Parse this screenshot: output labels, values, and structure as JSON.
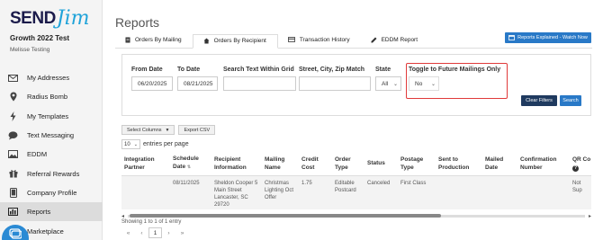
{
  "brand": {
    "send": "SEND",
    "jim": "Jim"
  },
  "account": {
    "name": "Growth 2022 Test",
    "user": "Melisse Testing"
  },
  "sidebar": {
    "items": [
      {
        "label": "My Addresses",
        "icon": "envelope-icon"
      },
      {
        "label": "Radius Bomb",
        "icon": "location-pin-icon"
      },
      {
        "label": "My Templates",
        "icon": "lightning-icon"
      },
      {
        "label": "Text Messaging",
        "icon": "chat-icon"
      },
      {
        "label": "EDDM",
        "icon": "image-icon"
      },
      {
        "label": "Referral Rewards",
        "icon": "gift-icon"
      },
      {
        "label": "Company Profile",
        "icon": "tablet-icon"
      },
      {
        "label": "Reports",
        "icon": "bar-chart-icon",
        "active": true
      },
      {
        "label": "Marketplace",
        "icon": "store-icon"
      }
    ]
  },
  "page": {
    "title": "Reports",
    "explain_button": "Reports Explained - Watch Now"
  },
  "tabs": [
    {
      "label": "Orders By Mailing",
      "icon": "document-icon"
    },
    {
      "label": "Orders By Recipient",
      "icon": "home-icon",
      "active": true
    },
    {
      "label": "Transaction History",
      "icon": "card-icon"
    },
    {
      "label": "EDDM Report",
      "icon": "pencil-icon"
    }
  ],
  "filters": {
    "from_date": {
      "label": "From Date",
      "value": "06/20/2025"
    },
    "to_date": {
      "label": "To Date",
      "value": "08/21/2025"
    },
    "search_text": {
      "label": "Search Text Within Grid",
      "value": ""
    },
    "address": {
      "label": "Street, City, Zip Match",
      "value": ""
    },
    "state": {
      "label": "State",
      "value": "All"
    },
    "future": {
      "label": "Toggle to Future Mailings Only",
      "value": "No"
    },
    "clear_label": "Clear Filters",
    "search_label": "Search"
  },
  "tools": {
    "select_columns": "Select Columns",
    "export_csv": "Export CSV"
  },
  "entries": {
    "value": "10",
    "suffix": "entries per page"
  },
  "table": {
    "columns": [
      "Integration Partner",
      "Schedule Date",
      "Recipient Information",
      "Mailing Name",
      "Credit Cost",
      "Order Type",
      "Status",
      "Postage Type",
      "Sent to Production",
      "Mailed Date",
      "Confirmation Number",
      "QR Co"
    ],
    "row": [
      "",
      "08/11/2025",
      "Sheldon Cooper 5 Main Street Lancaster, SC 29720",
      "Christmas Lighting Oct Offer",
      "1.75",
      "Editable Postcard",
      "Canceled",
      "First Class",
      "",
      "",
      "",
      "Not Sup"
    ]
  },
  "footer": {
    "showing": "Showing 1 to 1 of 1 entry",
    "pager": [
      "«",
      "‹",
      "1",
      "›",
      "»"
    ]
  },
  "colors": {
    "accent": "#2979c7",
    "highlight": "#e03a3a",
    "brand_dark": "#1b1b4b",
    "brand_light": "#20a3d9"
  }
}
